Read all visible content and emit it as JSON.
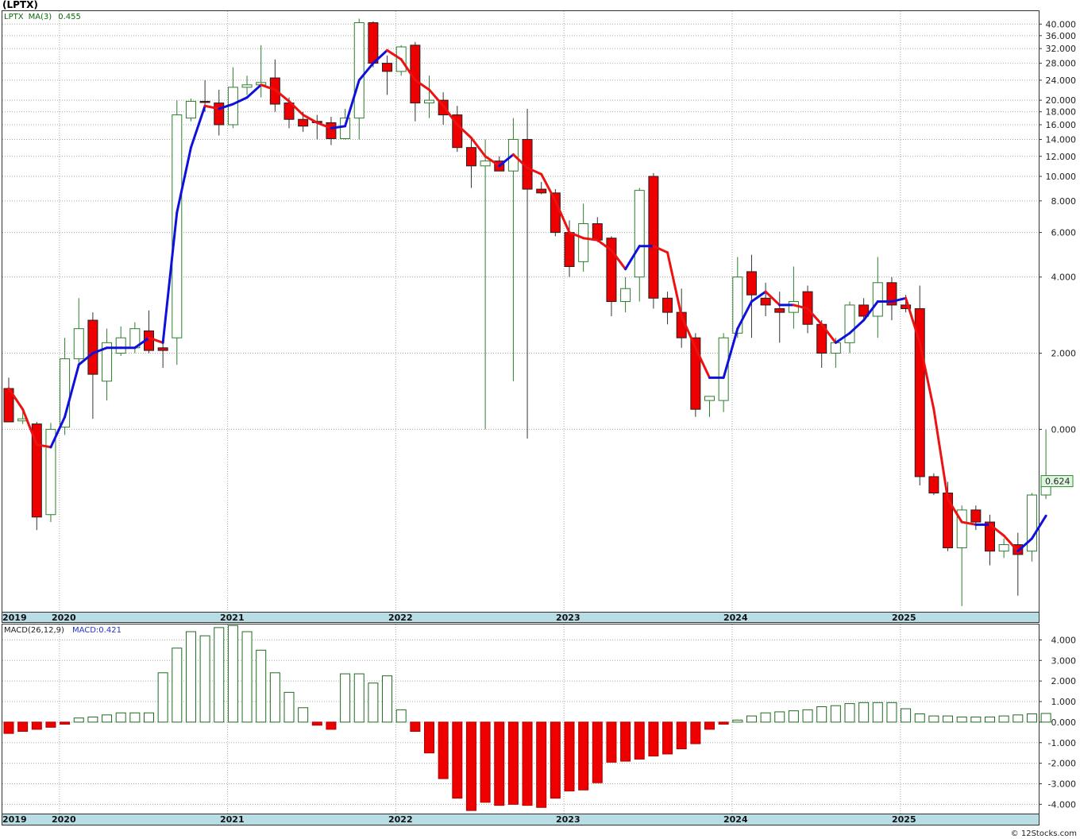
{
  "chart_data": [
    {
      "type": "candlestick",
      "title": "(LPTX)",
      "scale": "log",
      "grid": true,
      "legend": {
        "symbol": "LPTX",
        "ma_label": "MA(3)",
        "ma_value": "0.455"
      },
      "y_ticks": [
        "0.000",
        "2.000",
        "4.000",
        "6.000",
        "8.000",
        "10.000",
        "12.000",
        "14.000",
        "16.000",
        "18.000",
        "20.000",
        "24.000",
        "28.000",
        "32.000",
        "36.000",
        "40.000"
      ],
      "y_tick_values": [
        1.0,
        2.0,
        4.0,
        6.0,
        8.0,
        10.0,
        12.0,
        14.0,
        16.0,
        18.0,
        20.0,
        24.0,
        28.0,
        32.0,
        36.0,
        40.0
      ],
      "y_range": [
        0.19,
        45.0
      ],
      "last_price_label": "0.624",
      "last_price": 0.624,
      "x_labels": [
        "2019",
        "2020",
        "2021",
        "2022",
        "2023",
        "2024",
        "2025"
      ],
      "candles": [
        {
          "o": 1.45,
          "h": 1.6,
          "l": 1.07,
          "c": 1.07
        },
        {
          "o": 1.08,
          "h": 1.18,
          "l": 1.05,
          "c": 1.1
        },
        {
          "o": 1.05,
          "h": 1.07,
          "l": 0.4,
          "c": 0.45
        },
        {
          "o": 0.46,
          "h": 1.06,
          "l": 0.43,
          "c": 1.0
        },
        {
          "o": 1.02,
          "h": 2.3,
          "l": 0.95,
          "c": 1.9
        },
        {
          "o": 1.9,
          "h": 3.3,
          "l": 1.8,
          "c": 2.5
        },
        {
          "o": 2.7,
          "h": 2.9,
          "l": 1.1,
          "c": 1.65
        },
        {
          "o": 1.55,
          "h": 2.5,
          "l": 1.3,
          "c": 2.2
        },
        {
          "o": 2.0,
          "h": 2.55,
          "l": 1.95,
          "c": 2.3
        },
        {
          "o": 2.1,
          "h": 2.65,
          "l": 2.0,
          "c": 2.5
        },
        {
          "o": 2.45,
          "h": 2.95,
          "l": 2.0,
          "c": 2.05
        },
        {
          "o": 2.1,
          "h": 2.3,
          "l": 1.75,
          "c": 2.05
        },
        {
          "o": 2.3,
          "h": 20.0,
          "l": 1.8,
          "c": 17.5
        },
        {
          "o": 17.0,
          "h": 20.3,
          "l": 16.5,
          "c": 19.8
        },
        {
          "o": 19.8,
          "h": 24.0,
          "l": 18.0,
          "c": 19.6
        },
        {
          "o": 19.5,
          "h": 22.0,
          "l": 14.5,
          "c": 16.0
        },
        {
          "o": 16.0,
          "h": 27.0,
          "l": 15.5,
          "c": 22.5
        },
        {
          "o": 22.5,
          "h": 25.0,
          "l": 21.0,
          "c": 23.0
        },
        {
          "o": 23.0,
          "h": 33.0,
          "l": 20.5,
          "c": 23.5
        },
        {
          "o": 24.5,
          "h": 29.0,
          "l": 18.0,
          "c": 19.3
        },
        {
          "o": 19.5,
          "h": 20.5,
          "l": 15.5,
          "c": 16.8
        },
        {
          "o": 16.8,
          "h": 18.0,
          "l": 15.0,
          "c": 15.8
        },
        {
          "o": 16.5,
          "h": 17.5,
          "l": 14.0,
          "c": 16.3
        },
        {
          "o": 16.3,
          "h": 17.2,
          "l": 13.3,
          "c": 14.1
        },
        {
          "o": 14.1,
          "h": 18.5,
          "l": 14.0,
          "c": 17.0
        },
        {
          "o": 17.0,
          "h": 42.0,
          "l": 14.0,
          "c": 40.5
        },
        {
          "o": 40.5,
          "h": 41.0,
          "l": 27.0,
          "c": 28.0
        },
        {
          "o": 28.0,
          "h": 30.0,
          "l": 21.0,
          "c": 26.0
        },
        {
          "o": 26.0,
          "h": 33.0,
          "l": 25.0,
          "c": 32.5
        },
        {
          "o": 33.0,
          "h": 34.0,
          "l": 16.5,
          "c": 19.5
        },
        {
          "o": 19.5,
          "h": 25.0,
          "l": 17.0,
          "c": 20.0
        },
        {
          "o": 20.0,
          "h": 21.5,
          "l": 16.0,
          "c": 17.5
        },
        {
          "o": 17.5,
          "h": 19.0,
          "l": 12.5,
          "c": 13.0
        },
        {
          "o": 13.0,
          "h": 14.0,
          "l": 9.0,
          "c": 11.0
        },
        {
          "o": 11.0,
          "h": 14.0,
          "l": 1.0,
          "c": 11.5
        },
        {
          "o": 11.5,
          "h": 12.0,
          "l": 10.5,
          "c": 10.5
        },
        {
          "o": 10.5,
          "h": 17.0,
          "l": 1.55,
          "c": 14.0
        },
        {
          "o": 14.0,
          "h": 18.5,
          "l": 0.92,
          "c": 8.9
        },
        {
          "o": 8.9,
          "h": 9.5,
          "l": 8.5,
          "c": 8.6
        },
        {
          "o": 8.6,
          "h": 8.9,
          "l": 5.8,
          "c": 6.0
        },
        {
          "o": 6.0,
          "h": 6.7,
          "l": 4.0,
          "c": 4.4
        },
        {
          "o": 4.6,
          "h": 7.8,
          "l": 4.2,
          "c": 6.5
        },
        {
          "o": 6.5,
          "h": 6.9,
          "l": 5.5,
          "c": 5.6
        },
        {
          "o": 5.7,
          "h": 5.8,
          "l": 2.8,
          "c": 3.2
        },
        {
          "o": 3.2,
          "h": 4.0,
          "l": 2.9,
          "c": 3.6
        },
        {
          "o": 4.0,
          "h": 9.0,
          "l": 3.2,
          "c": 8.8
        },
        {
          "o": 10.0,
          "h": 10.3,
          "l": 3.0,
          "c": 3.3
        },
        {
          "o": 3.3,
          "h": 3.5,
          "l": 2.6,
          "c": 2.9
        },
        {
          "o": 2.9,
          "h": 3.6,
          "l": 2.1,
          "c": 2.3
        },
        {
          "o": 2.3,
          "h": 2.4,
          "l": 1.12,
          "c": 1.2
        },
        {
          "o": 1.3,
          "h": 1.35,
          "l": 1.12,
          "c": 1.35
        },
        {
          "o": 1.3,
          "h": 2.4,
          "l": 1.17,
          "c": 2.3
        },
        {
          "o": 2.4,
          "h": 4.8,
          "l": 2.3,
          "c": 4.0
        },
        {
          "o": 4.2,
          "h": 4.9,
          "l": 2.3,
          "c": 3.4
        },
        {
          "o": 3.3,
          "h": 3.8,
          "l": 2.8,
          "c": 3.1
        },
        {
          "o": 3.0,
          "h": 3.5,
          "l": 2.2,
          "c": 2.9
        },
        {
          "o": 2.9,
          "h": 4.4,
          "l": 2.5,
          "c": 3.2
        },
        {
          "o": 3.5,
          "h": 3.7,
          "l": 2.4,
          "c": 2.6
        },
        {
          "o": 2.6,
          "h": 2.7,
          "l": 1.75,
          "c": 2.0
        },
        {
          "o": 2.0,
          "h": 2.3,
          "l": 1.75,
          "c": 2.2
        },
        {
          "o": 2.2,
          "h": 3.2,
          "l": 2.0,
          "c": 3.1
        },
        {
          "o": 3.1,
          "h": 3.3,
          "l": 2.7,
          "c": 2.8
        },
        {
          "o": 2.8,
          "h": 4.8,
          "l": 2.3,
          "c": 3.8
        },
        {
          "o": 3.8,
          "h": 4.0,
          "l": 2.7,
          "c": 3.1
        },
        {
          "o": 3.1,
          "h": 3.4,
          "l": 2.9,
          "c": 3.0
        },
        {
          "o": 3.0,
          "h": 3.7,
          "l": 0.6,
          "c": 0.65
        },
        {
          "o": 0.65,
          "h": 0.67,
          "l": 0.55,
          "c": 0.56
        },
        {
          "o": 0.56,
          "h": 0.62,
          "l": 0.33,
          "c": 0.34
        },
        {
          "o": 0.34,
          "h": 0.5,
          "l": 0.2,
          "c": 0.48
        },
        {
          "o": 0.48,
          "h": 0.5,
          "l": 0.4,
          "c": 0.43
        },
        {
          "o": 0.43,
          "h": 0.46,
          "l": 0.29,
          "c": 0.33
        },
        {
          "o": 0.33,
          "h": 0.37,
          "l": 0.31,
          "c": 0.35
        },
        {
          "o": 0.35,
          "h": 0.39,
          "l": 0.22,
          "c": 0.32
        },
        {
          "o": 0.33,
          "h": 0.56,
          "l": 0.3,
          "c": 0.55
        },
        {
          "o": 0.55,
          "h": 1.0,
          "l": 0.53,
          "c": 0.624
        }
      ],
      "ma3": [
        1.45,
        1.2,
        0.87,
        0.85,
        1.12,
        1.8,
        2.0,
        2.1,
        2.1,
        2.1,
        2.3,
        2.2,
        7.2,
        13.0,
        19.0,
        18.5,
        19.3,
        20.5,
        23.0,
        22.0,
        19.8,
        17.5,
        16.3,
        15.5,
        15.8,
        24.0,
        28.0,
        31.5,
        29.0,
        24.0,
        22.0,
        19.0,
        16.0,
        14.2,
        12.0,
        11.0,
        12.2,
        10.8,
        10.2,
        8.0,
        6.0,
        5.7,
        5.6,
        5.1,
        4.3,
        5.3,
        5.3,
        5.0,
        2.8,
        2.1,
        1.6,
        1.6,
        2.5,
        3.2,
        3.5,
        3.1,
        3.1,
        3.0,
        2.6,
        2.2,
        2.4,
        2.7,
        3.2,
        3.2,
        3.3,
        2.2,
        1.2,
        0.53,
        0.43,
        0.42,
        0.42,
        0.38,
        0.33,
        0.37,
        0.455
      ]
    },
    {
      "type": "bar",
      "title": "MACD(26,12,9)",
      "value_label": "MACD:0.421",
      "y_ticks": [
        "4.000",
        "3.000",
        "2.000",
        "1.000",
        "0.000",
        "-1.000",
        "-2.000",
        "-3.000",
        "-4.000"
      ],
      "y_tick_values": [
        4,
        3,
        2,
        1,
        0,
        -1,
        -2,
        -3,
        -4
      ],
      "y_range": [
        -4.45,
        4.75
      ],
      "x_labels": [
        "2019",
        "2020",
        "2021",
        "2022",
        "2023",
        "2024",
        "2025"
      ],
      "values": [
        -0.55,
        -0.45,
        -0.35,
        -0.25,
        -0.1,
        0.2,
        0.25,
        0.35,
        0.45,
        0.45,
        0.45,
        2.4,
        3.6,
        4.4,
        4.2,
        4.6,
        4.7,
        4.4,
        3.5,
        2.4,
        1.45,
        0.7,
        -0.15,
        -0.35,
        2.35,
        2.35,
        1.9,
        2.25,
        0.6,
        -0.45,
        -1.5,
        -2.75,
        -3.7,
        -4.3,
        -3.9,
        -4.05,
        -4.0,
        -4.05,
        -4.15,
        -3.7,
        -3.35,
        -3.3,
        -2.95,
        -1.95,
        -1.9,
        -1.8,
        -1.65,
        -1.55,
        -1.3,
        -1.05,
        -0.35,
        -0.1,
        0.1,
        0.3,
        0.45,
        0.5,
        0.55,
        0.6,
        0.75,
        0.8,
        0.9,
        0.95,
        0.95,
        0.95,
        0.65,
        0.4,
        0.3,
        0.3,
        0.25,
        0.25,
        0.25,
        0.3,
        0.35,
        0.4,
        0.421
      ]
    }
  ],
  "credit": "© 12Stocks.com"
}
